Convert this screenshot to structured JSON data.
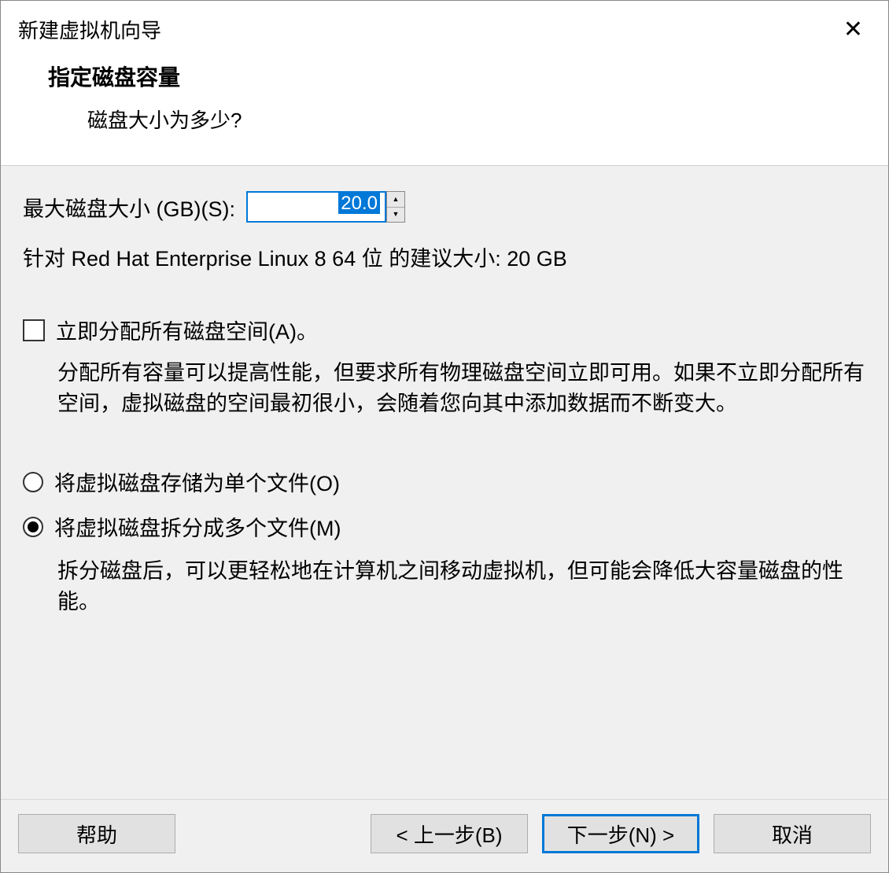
{
  "titlebar": {
    "title": "新建虚拟机向导"
  },
  "header": {
    "title": "指定磁盘容量",
    "subtitle": "磁盘大小为多少?"
  },
  "content": {
    "size_label": "最大磁盘大小 (GB)(S):",
    "size_value": "20.0",
    "recommend_text": "针对 Red Hat Enterprise Linux 8 64 位 的建议大小: 20 GB",
    "allocate_checkbox_label": "立即分配所有磁盘空间(A)。",
    "allocate_desc": "分配所有容量可以提高性能，但要求所有物理磁盘空间立即可用。如果不立即分配所有空间，虚拟磁盘的空间最初很小，会随着您向其中添加数据而不断变大。",
    "radio_single_label": "将虚拟磁盘存储为单个文件(O)",
    "radio_split_label": "将虚拟磁盘拆分成多个文件(M)",
    "radio_split_desc": "拆分磁盘后，可以更轻松地在计算机之间移动虚拟机，但可能会降低大容量磁盘的性能。"
  },
  "buttons": {
    "help": "帮助",
    "back": "< 上一步(B)",
    "next": "下一步(N) >",
    "cancel": "取消"
  }
}
